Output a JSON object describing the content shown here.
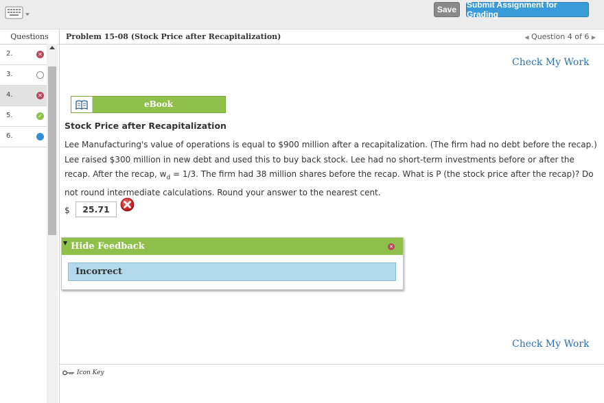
{
  "toolbar": {
    "save_label": "Save",
    "submit_label": "Submit Assignment for Grading"
  },
  "sidebar": {
    "header": "Questions",
    "items": [
      {
        "number": "2.",
        "status": "incorrect"
      },
      {
        "number": "3.",
        "status": "unanswered"
      },
      {
        "number": "4.",
        "status": "incorrect"
      },
      {
        "number": "5.",
        "status": "correct"
      },
      {
        "number": "6.",
        "status": "current"
      }
    ]
  },
  "problem": {
    "title": "Problem 15-08 (Stock Price after Recapitalization)",
    "nav_label": "Question 4 of 6",
    "check_top": "Check My Work",
    "check_bottom": "Check My Work",
    "ebook_label": "eBook",
    "heading": "Stock Price after Recapitalization",
    "text_part1": "Lee Manufacturing's value of operations is equal to $900 million after a recapitalization. (The firm had no debt before the recap.) Lee raised $300 million in new debt and used this to buy back stock. Lee had no short-term investments before or after the recap. After the recap, w",
    "text_sub": "d",
    "text_part2": " = 1/3. The firm had 38 million shares before the recap. What is P (the stock price after the recap)? Do not round intermediate calculations. Round your answer to the nearest cent.",
    "currency": "$",
    "answer_value": "25.71"
  },
  "feedback": {
    "toggle_label": "Hide Feedback",
    "result": "Incorrect"
  },
  "footer": {
    "icon_key_label": "Icon Key"
  },
  "colors": {
    "green": "#8fc04a",
    "blue": "#3a9bd9",
    "incorrect": "#b9475f",
    "link": "#2a6fb0"
  }
}
